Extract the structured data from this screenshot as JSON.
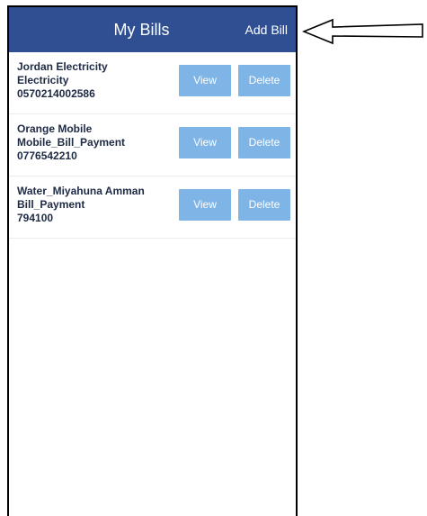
{
  "header": {
    "title": "My Bills",
    "add_label": "Add Bill"
  },
  "bills": [
    {
      "line1": "Jordan Electricity",
      "line2": "Electricity",
      "line3": "0570214002586",
      "view_label": "View",
      "delete_label": "Delete"
    },
    {
      "line1": "Orange Mobile",
      "line2": "Mobile_Bill_Payment",
      "line3": "0776542210",
      "view_label": "View",
      "delete_label": "Delete"
    },
    {
      "line1": "Water_Miyahuna Amman",
      "line2": "Bill_Payment",
      "line3": "794100",
      "view_label": "View",
      "delete_label": "Delete"
    }
  ],
  "colors": {
    "header_bg": "#2f4f92",
    "button_bg": "#7fb4e7"
  },
  "icons": {
    "annotation": "left-arrow-icon"
  }
}
